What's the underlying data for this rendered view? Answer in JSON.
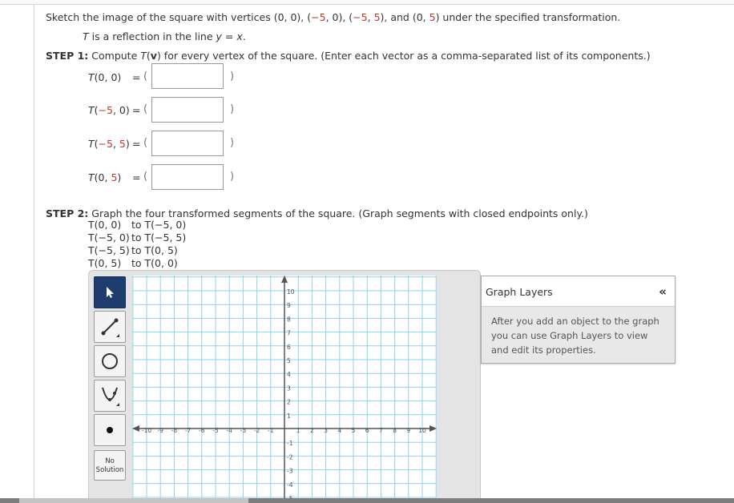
{
  "problem": {
    "intro_before": "Sketch the image of the square with vertices (0, 0), (",
    "v2a": "−5",
    "mid1": ", 0), (",
    "v3a": "−5",
    "mid2": ", ",
    "v3b": "5",
    "mid3": "), and (0, ",
    "v4b": "5",
    "intro_after": ") under the specified transformation.",
    "t_symbol": "T",
    "t_desc_mid": " is a reflection in the line ",
    "t_line": "y = x",
    "t_desc_end": "."
  },
  "step1": {
    "label": "STEP 1:",
    "instruction_pre": "Compute ",
    "instruction_t": "T",
    "instruction_v_open": "(",
    "instruction_v": "v",
    "instruction_post": ") for every vertex of the square. (Enter each vector as a comma-separated list of its components.)",
    "rows": [
      {
        "t": "T",
        "open": "(",
        "a": "0",
        "comma": ", ",
        "b": "0",
        "close": ")",
        "eq": "=",
        "lparen": "(",
        "rparen": ")",
        "value": ""
      },
      {
        "t": "T",
        "open": "(",
        "a": "−5",
        "comma": ", ",
        "b": "0",
        "close": ")",
        "eq": "=",
        "lparen": "(",
        "rparen": ")",
        "value": ""
      },
      {
        "t": "T",
        "open": "(",
        "a": "−5",
        "comma": ", ",
        "b": "5",
        "close": ")",
        "eq": "=",
        "lparen": "(",
        "rparen": ")",
        "value": ""
      },
      {
        "t": "T",
        "open": "(",
        "a": "0",
        "comma": ", ",
        "b": "5",
        "close": ")",
        "eq": "=",
        "lparen": "(",
        "rparen": ")",
        "value": ""
      }
    ]
  },
  "step2": {
    "label": "STEP 2:",
    "instruction": "Graph the four transformed segments of the square. (Graph segments with closed endpoints only.)",
    "segments": [
      {
        "p1": "T(0, 0)",
        "to": "to",
        "p2": "T(−5, 0)"
      },
      {
        "p1": "T(−5, 0)",
        "to": "to",
        "p2": "T(−5, 5)"
      },
      {
        "p1": "T(−5, 5)",
        "to": "to",
        "p2": "T(0, 5)"
      },
      {
        "p1": "T(0, 5)",
        "to": "to",
        "p2": "T(0, 0)"
      }
    ]
  },
  "toolbar": {
    "tools": [
      {
        "icon": "pointer-arrow-icon"
      },
      {
        "icon": "line-segment-icon"
      },
      {
        "icon": "circle-icon"
      },
      {
        "icon": "parabola-icon"
      },
      {
        "icon": "point-icon"
      }
    ],
    "no_solution_line1": "No",
    "no_solution_line2": "Solution"
  },
  "graph": {
    "x_ticks": [
      "-10",
      "-9",
      "-8",
      "-7",
      "-6",
      "-5",
      "-4",
      "-3",
      "-2",
      "-1",
      "1",
      "2",
      "3",
      "4",
      "5",
      "6",
      "7",
      "8",
      "9",
      "10"
    ],
    "y_ticks_pos": [
      "10",
      "9",
      "8",
      "7",
      "6",
      "5",
      "4",
      "3",
      "2",
      "1"
    ],
    "y_ticks_neg": [
      "-1",
      "-2",
      "-3",
      "-4",
      "-5"
    ],
    "grid_color": "#8fd3e8",
    "axis_color": "#555555"
  },
  "layers": {
    "title": "Graph Layers",
    "collapse": "«",
    "body": "After you add an object to the graph you can use Graph Layers to view and edit its properties."
  }
}
